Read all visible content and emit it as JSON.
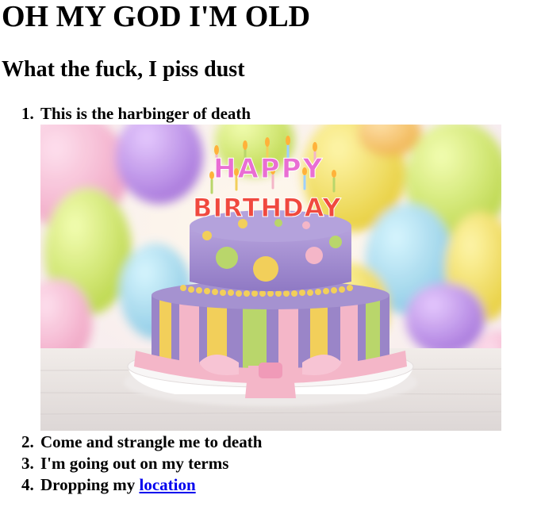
{
  "page": {
    "heading": "OH MY GOD I'M OLD",
    "subheading": "What the fuck, I piss dust"
  },
  "list": {
    "items": [
      {
        "number": "1.",
        "text": "This is the harbinger of death"
      },
      {
        "number": "2.",
        "text": "Come and strangle me to death"
      },
      {
        "number": "3.",
        "text": "I'm going out on my terms"
      },
      {
        "number": "4.",
        "text": "Dropping my ",
        "link": "location"
      }
    ]
  },
  "image": {
    "cake_topper_top": "HAPPY",
    "cake_topper_bottom": "BIRTHDAY"
  },
  "colors": {
    "link": "#0000ee",
    "cake_purple": "#9b86c8",
    "ribbon_pink": "#f4b6c8",
    "accent_yellow": "#f2cf5a",
    "accent_green": "#b9d66b"
  }
}
